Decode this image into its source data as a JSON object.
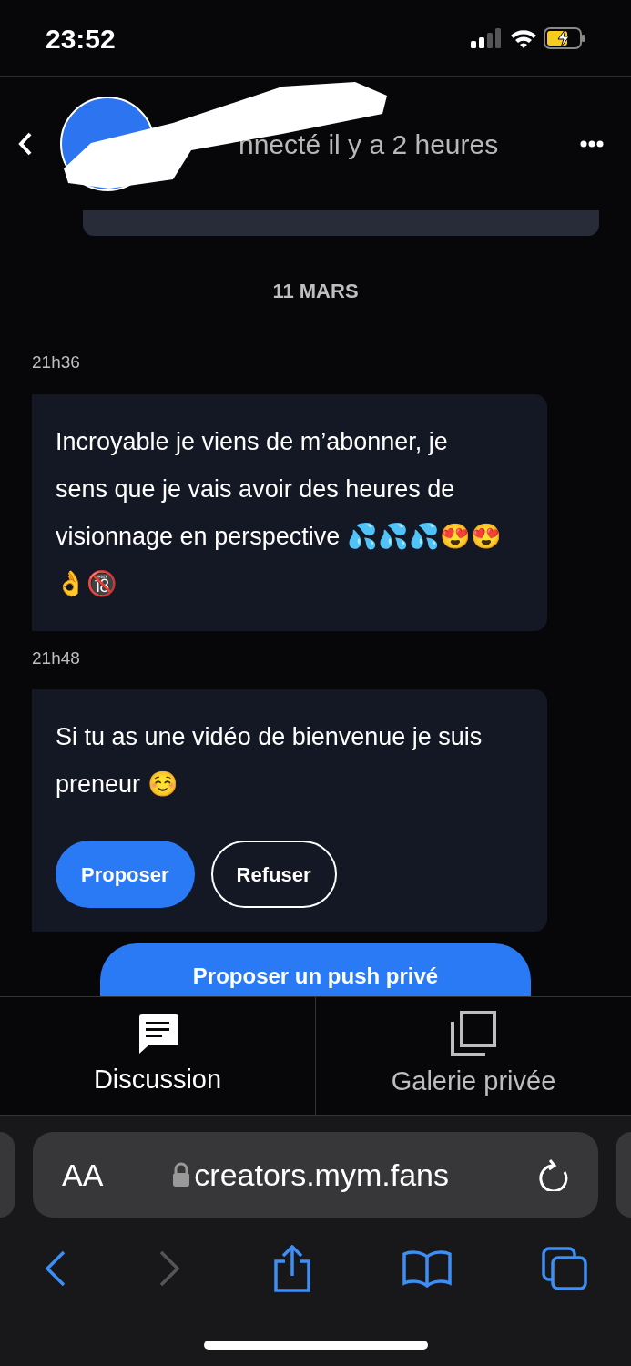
{
  "status_bar": {
    "time": "23:52"
  },
  "header": {
    "status": "nnecté il y a 2 heures"
  },
  "date_separator": "11 MARS",
  "messages": [
    {
      "time": "21h36",
      "text": "Incroyable je viens de m’abonner, je sens que je vais avoir des heures de visionnage en perspective 💦💦💦😍😍 👌🔞"
    },
    {
      "time": "21h48",
      "text": "Si tu as une vidéo de bienvenue je suis preneur ☺️",
      "actions": [
        {
          "label": "Proposer",
          "primary": true
        },
        {
          "label": "Refuser",
          "primary": false
        }
      ]
    }
  ],
  "push_button": "Proposer un push privé",
  "tabs": [
    {
      "label": "Discussion",
      "selected": true,
      "kind": "chat"
    },
    {
      "label": "Galerie privée",
      "selected": false,
      "kind": "gallery"
    }
  ],
  "browser": {
    "text_size": "AA",
    "url": "creators.mym.fans",
    "forward_disabled": true
  }
}
